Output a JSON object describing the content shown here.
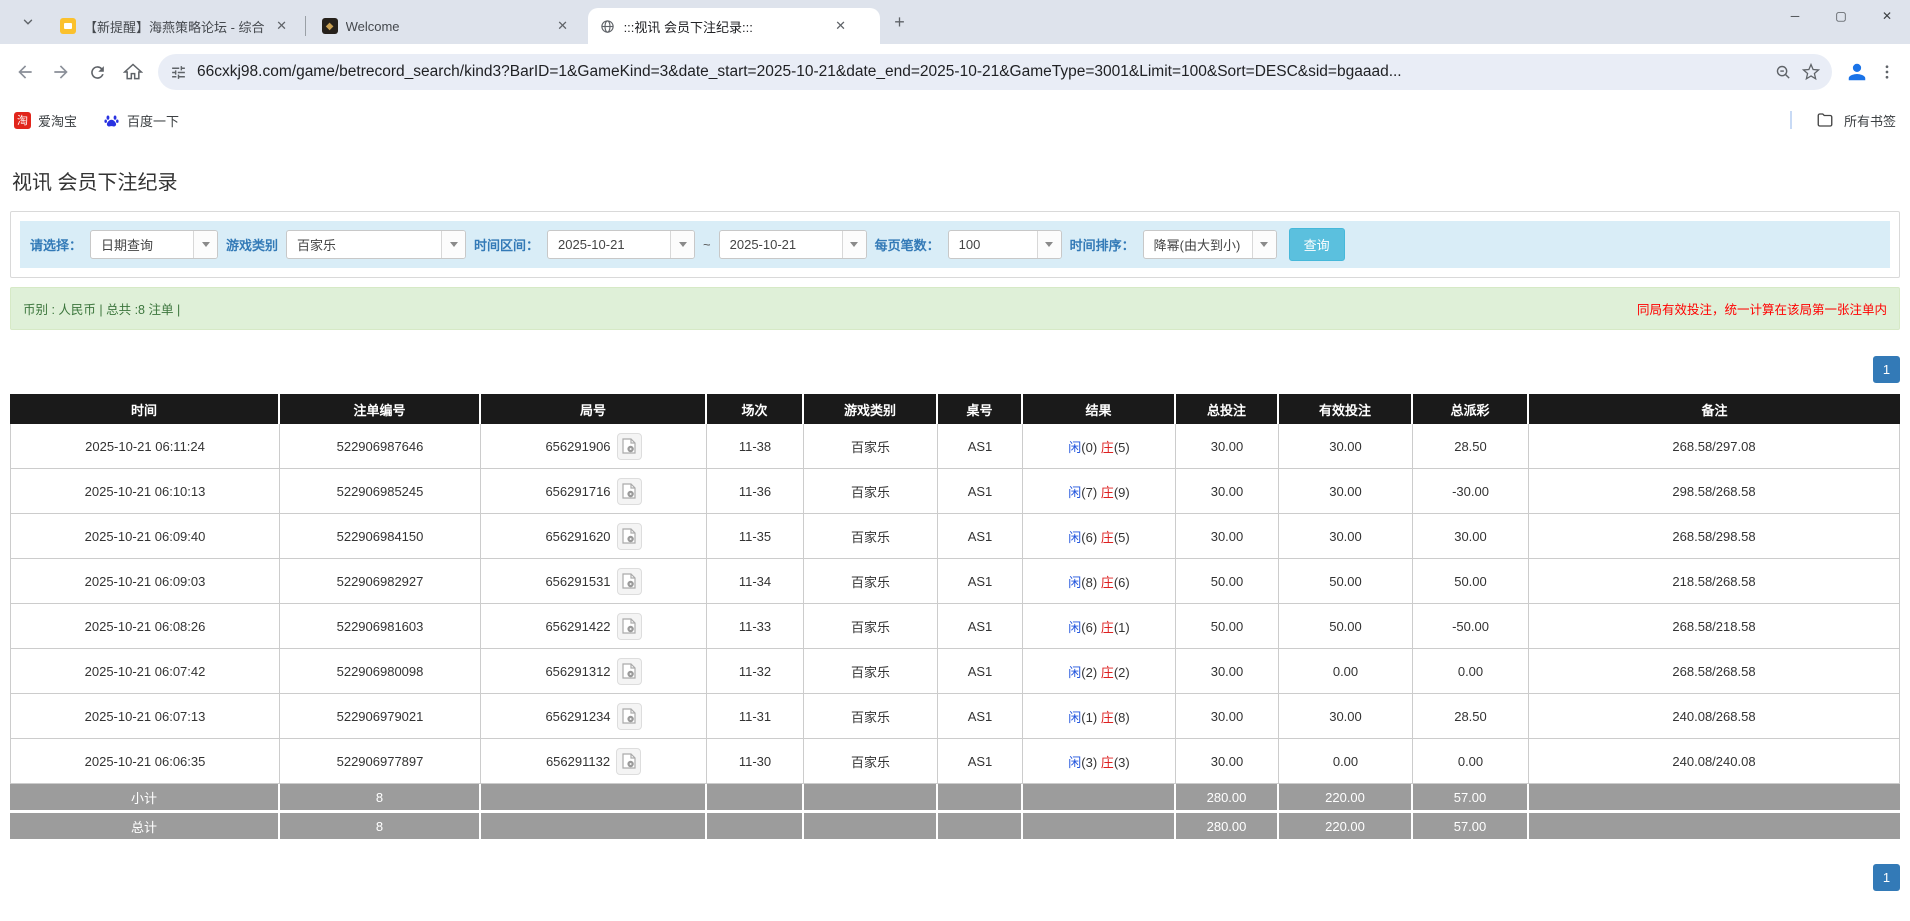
{
  "browser": {
    "tabs": [
      {
        "title": "【新提醒】海燕策略论坛 - 综合",
        "favicon": "forum-yellow-icon"
      },
      {
        "title": "Welcome",
        "favicon": "golden-crest-icon"
      },
      {
        "title": ":::视讯 会员下注纪录:::",
        "favicon": "globe-icon"
      }
    ],
    "url": "66cxkj98.com/game/betrecord_search/kind3?BarID=1&GameKind=3&date_start=2025-10-21&date_end=2025-10-21&GameType=3001&Limit=100&Sort=DESC&sid=bgaaad...",
    "bookmarks": [
      {
        "label": "爱淘宝",
        "icon": "taobao-icon"
      },
      {
        "label": "百度一下",
        "icon": "baidu-paw-icon"
      }
    ],
    "all_bookmarks_label": "所有书签"
  },
  "page": {
    "title": "视讯 会员下注纪录",
    "filters": {
      "select_label": "请选择：",
      "select_value": "日期查询",
      "game_label": "游戏类别",
      "game_value": "百家乐",
      "range_label": "时间区间：",
      "date_start": "2025-10-21",
      "tilde": "~",
      "date_end": "2025-10-21",
      "per_page_label": "每页笔数：",
      "per_page_value": "100",
      "sort_label": "时间排序：",
      "sort_value": "降幂(由大到小)",
      "search_button": "查询"
    },
    "summary": {
      "left": "币别 : 人民币 | 总共 :8 注单 |",
      "right": "同局有效投注，统一计算在该局第一张注单内"
    },
    "pagination": "1",
    "colors": {
      "accent_blue": "#337ab7",
      "negative_red": "#e60000",
      "player_blue": "#2255dd",
      "banker_red": "#dd2222",
      "header_bg": "#1a1a1a",
      "footer_bg": "#9c9c9c",
      "filter_bg": "#d9edf7",
      "summary_bg": "#dff0d8",
      "search_button_bg": "#5bc0de"
    },
    "table": {
      "headers": [
        "时间",
        "注单编号",
        "局号",
        "场次",
        "游戏类别",
        "桌号",
        "结果",
        "总投注",
        "有效投注",
        "总派彩",
        "备注"
      ],
      "rows": [
        {
          "time": "2025-10-21 06:11:24",
          "bet_id": "522906987646",
          "round": "656291906",
          "session": "11-38",
          "game": "百家乐",
          "table_no": "AS1",
          "result_player": "闲(0)",
          "result_banker": "庄(5)",
          "total_bet": "30.00",
          "valid_bet": "30.00",
          "payout": "28.50",
          "note": "268.58/297.08"
        },
        {
          "time": "2025-10-21 06:10:13",
          "bet_id": "522906985245",
          "round": "656291716",
          "session": "11-36",
          "game": "百家乐",
          "table_no": "AS1",
          "result_player": "闲(7)",
          "result_banker": "庄(9)",
          "total_bet": "30.00",
          "valid_bet": "30.00",
          "payout": "-30.00",
          "note": "298.58/268.58"
        },
        {
          "time": "2025-10-21 06:09:40",
          "bet_id": "522906984150",
          "round": "656291620",
          "session": "11-35",
          "game": "百家乐",
          "table_no": "AS1",
          "result_player": "闲(6)",
          "result_banker": "庄(5)",
          "total_bet": "30.00",
          "valid_bet": "30.00",
          "payout": "30.00",
          "note": "268.58/298.58"
        },
        {
          "time": "2025-10-21 06:09:03",
          "bet_id": "522906982927",
          "round": "656291531",
          "session": "11-34",
          "game": "百家乐",
          "table_no": "AS1",
          "result_player": "闲(8)",
          "result_banker": "庄(6)",
          "total_bet": "50.00",
          "valid_bet": "50.00",
          "payout": "50.00",
          "note": "218.58/268.58"
        },
        {
          "time": "2025-10-21 06:08:26",
          "bet_id": "522906981603",
          "round": "656291422",
          "session": "11-33",
          "game": "百家乐",
          "table_no": "AS1",
          "result_player": "闲(6)",
          "result_banker": "庄(1)",
          "total_bet": "50.00",
          "valid_bet": "50.00",
          "payout": "-50.00",
          "note": "268.58/218.58"
        },
        {
          "time": "2025-10-21 06:07:42",
          "bet_id": "522906980098",
          "round": "656291312",
          "session": "11-32",
          "game": "百家乐",
          "table_no": "AS1",
          "result_player": "闲(2)",
          "result_banker": "庄(2)",
          "total_bet": "30.00",
          "valid_bet": "0.00",
          "payout": "0.00",
          "note": "268.58/268.58"
        },
        {
          "time": "2025-10-21 06:07:13",
          "bet_id": "522906979021",
          "round": "656291234",
          "session": "11-31",
          "game": "百家乐",
          "table_no": "AS1",
          "result_player": "闲(1)",
          "result_banker": "庄(8)",
          "total_bet": "30.00",
          "valid_bet": "30.00",
          "payout": "28.50",
          "note": "240.08/268.58"
        },
        {
          "time": "2025-10-21 06:06:35",
          "bet_id": "522906977897",
          "round": "656291132",
          "session": "11-30",
          "game": "百家乐",
          "table_no": "AS1",
          "result_player": "闲(3)",
          "result_banker": "庄(3)",
          "total_bet": "30.00",
          "valid_bet": "0.00",
          "payout": "0.00",
          "note": "240.08/240.08"
        }
      ],
      "subtotal": {
        "label": "小计",
        "count": "8",
        "total_bet": "280.00",
        "valid_bet": "220.00",
        "payout": "57.00"
      },
      "total": {
        "label": "总计",
        "count": "8",
        "total_bet": "280.00",
        "valid_bet": "220.00",
        "payout": "57.00"
      }
    }
  }
}
